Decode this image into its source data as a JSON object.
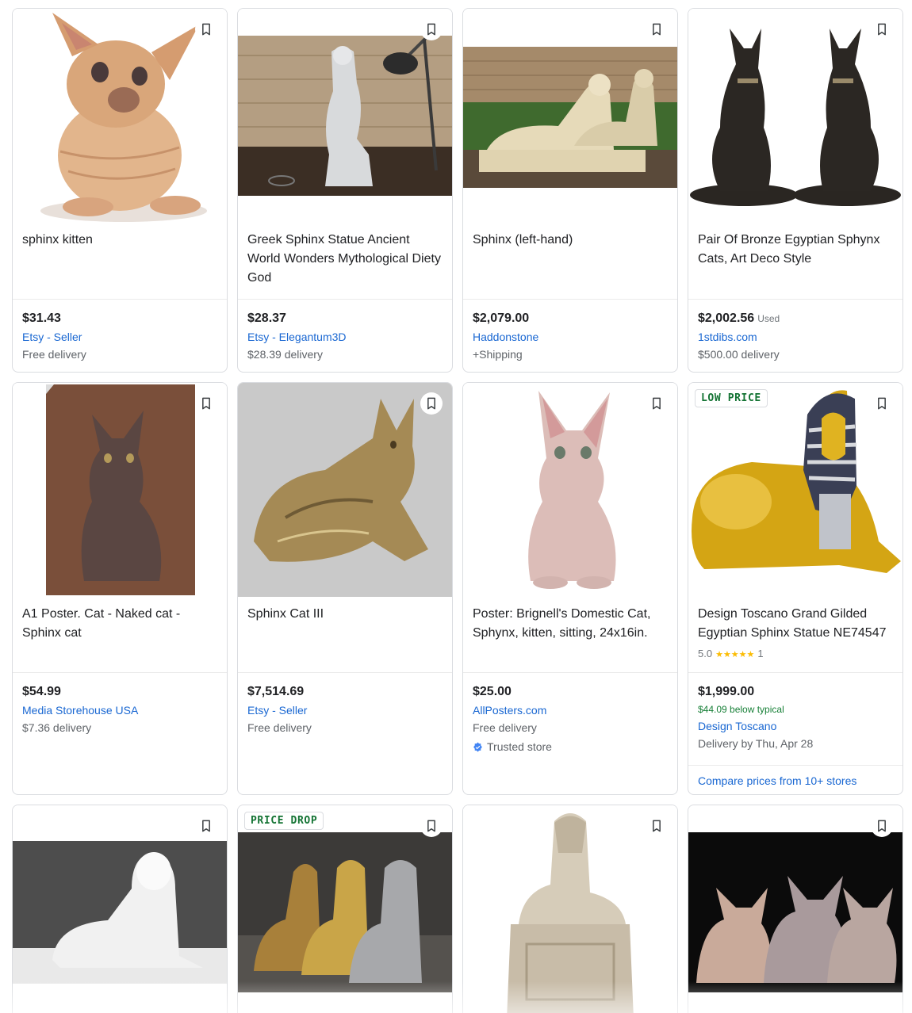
{
  "bookmark_icon": "bookmark-outline-icon",
  "colors": {
    "link": "#1967d2",
    "green": "#188038",
    "badge": "#137333",
    "star": "#fbbc04"
  },
  "products": [
    {
      "title": "sphinx kitten",
      "price": "$31.43",
      "seller": "Etsy - Seller",
      "shipping": "Free delivery"
    },
    {
      "title": "Greek Sphinx Statue Ancient World Wonders Mythological Diety God",
      "price": "$28.37",
      "seller": "Etsy - Elegantum3D",
      "shipping": "$28.39 delivery"
    },
    {
      "title": "Sphinx (left-hand)",
      "price": "$2,079.00",
      "seller": "Haddonstone",
      "shipping": "+Shipping"
    },
    {
      "title": "Pair Of Bronze Egyptian Sphynx Cats, Art Deco Style",
      "price": "$2,002.56",
      "condition": "Used",
      "seller": "1stdibs.com",
      "shipping": "$500.00 delivery"
    },
    {
      "title": "A1 Poster. Cat - Naked cat - Sphinx cat",
      "price": "$54.99",
      "seller": "Media Storehouse USA",
      "shipping": "$7.36 delivery"
    },
    {
      "title": "Sphinx Cat III",
      "price": "$7,514.69",
      "seller": "Etsy - Seller",
      "shipping": "Free delivery"
    },
    {
      "title": "Poster: Brignell's Domestic Cat, Sphynx, kitten, sitting, 24x16in.",
      "price": "$25.00",
      "seller": "AllPosters.com",
      "shipping": "Free delivery",
      "trusted": "Trusted store"
    },
    {
      "title": "Design Toscano Grand Gilded Egyptian Sphinx Statue NE74547",
      "badge": "LOW PRICE",
      "rating": "5.0",
      "stars": 5,
      "reviews": "1",
      "price": "$1,999.00",
      "typical": "$44.09 below typical",
      "seller": "Design Toscano",
      "shipping": "Delivery by Thu, Apr 28",
      "compare": "Compare prices from 10+ stores"
    },
    {
      "title": ""
    },
    {
      "title": "",
      "badge": "PRICE DROP"
    },
    {
      "title": ""
    },
    {
      "title": ""
    }
  ]
}
